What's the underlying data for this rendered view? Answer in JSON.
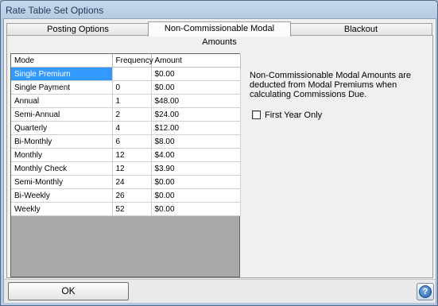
{
  "window": {
    "title": "Rate Table Set Options"
  },
  "tabs": [
    {
      "label": "Posting Options",
      "active": false
    },
    {
      "label": "Non-Commissionable Modal Amounts",
      "active": true
    },
    {
      "label": "Blackout",
      "active": false
    }
  ],
  "grid": {
    "columns": [
      "Mode",
      "Frequency",
      "Amount"
    ],
    "rows": [
      {
        "mode": "Single Premium",
        "frequency": "",
        "amount": "$0.00",
        "selected": true
      },
      {
        "mode": "Single Payment",
        "frequency": "0",
        "amount": "$0.00"
      },
      {
        "mode": "Annual",
        "frequency": "1",
        "amount": "$48.00"
      },
      {
        "mode": "Semi-Annual",
        "frequency": "2",
        "amount": "$24.00"
      },
      {
        "mode": "Quarterly",
        "frequency": "4",
        "amount": "$12.00"
      },
      {
        "mode": "Bi-Monthly",
        "frequency": "6",
        "amount": "$8.00"
      },
      {
        "mode": "Monthly",
        "frequency": "12",
        "amount": "$4.00"
      },
      {
        "mode": "Monthly Check",
        "frequency": "12",
        "amount": "$3.90"
      },
      {
        "mode": "Semi-Monthly",
        "frequency": "24",
        "amount": "$0.00"
      },
      {
        "mode": "Bi-Weekly",
        "frequency": "26",
        "amount": "$0.00"
      },
      {
        "mode": "Weekly",
        "frequency": "52",
        "amount": "$0.00"
      }
    ]
  },
  "description": "Non-Commissionable Modal Amounts are deducted from Modal Premiums when calculating Commissions Due.",
  "first_year_only": {
    "label": "First Year Only",
    "checked": false
  },
  "buttons": {
    "ok": "OK",
    "help_glyph": "?"
  },
  "icons": {
    "help": "help-icon"
  },
  "colors": {
    "selection": "#3399ff",
    "title_bar": "#c7d8ec"
  }
}
